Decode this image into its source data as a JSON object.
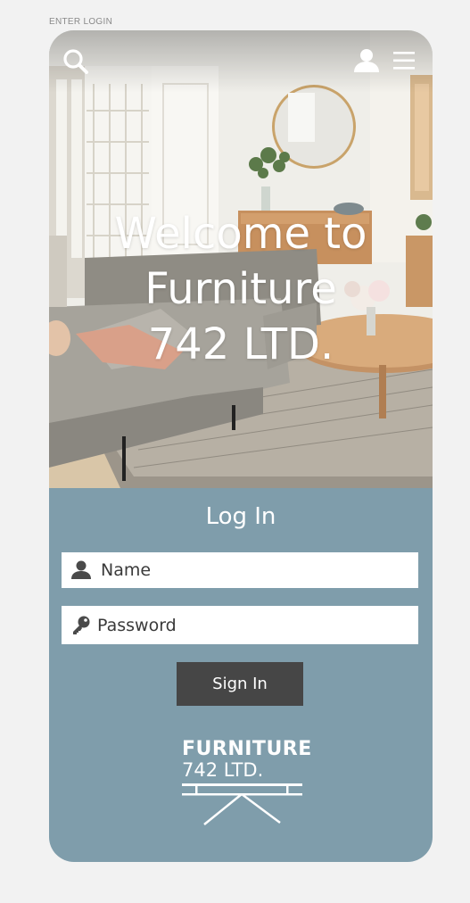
{
  "screen": {
    "caption": "ENTER LOGIN"
  },
  "header": {
    "icons": [
      "search-icon",
      "user-icon",
      "hamburger-menu-icon"
    ]
  },
  "hero": {
    "headline_lines": [
      "Welcome to",
      "Furniture",
      "742 LTD."
    ],
    "image": "living-room-photo"
  },
  "login": {
    "title": "Log In",
    "name_placeholder": "Name",
    "password_placeholder": "Password",
    "signin_label": "Sign In"
  },
  "brand": {
    "line1": "FURNITURE",
    "line2": "742 LTD."
  },
  "colors": {
    "page_background": "#f2f2f2",
    "panel": "#7f9dab",
    "button": "#464646",
    "text_on_panel": "#ffffff"
  }
}
